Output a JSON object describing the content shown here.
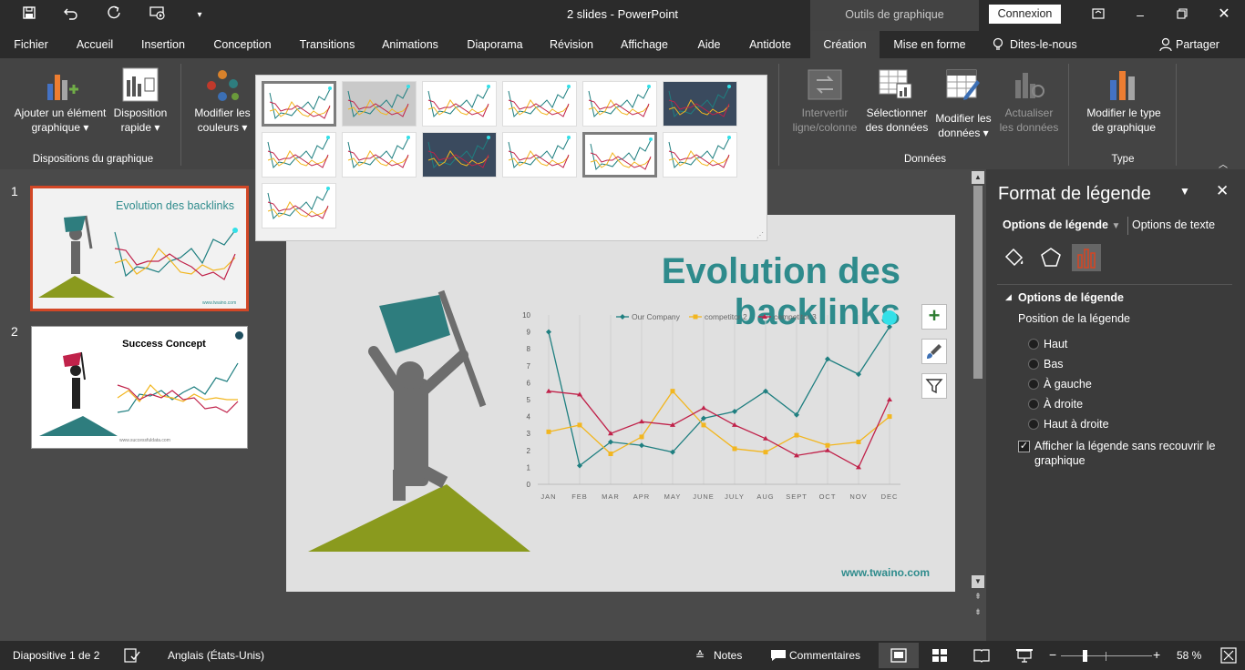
{
  "window": {
    "doc_title": "2 slides  -  PowerPoint",
    "tools_context": "Outils de graphique",
    "connexion": "Connexion"
  },
  "tabs": [
    {
      "label": "Fichier"
    },
    {
      "label": "Accueil"
    },
    {
      "label": "Insertion"
    },
    {
      "label": "Conception"
    },
    {
      "label": "Transitions"
    },
    {
      "label": "Animations"
    },
    {
      "label": "Diaporama"
    },
    {
      "label": "Révision"
    },
    {
      "label": "Affichage"
    },
    {
      "label": "Aide"
    },
    {
      "label": "Antidote"
    },
    {
      "label": "Création"
    },
    {
      "label": "Mise en forme"
    }
  ],
  "tell_me": "Dites-le-nous",
  "share": "Partager",
  "ribbon": {
    "add_element": [
      "Ajouter un élément",
      "graphique"
    ],
    "quick_layout": [
      "Disposition",
      "rapide"
    ],
    "change_colors": [
      "Modifier les",
      "couleurs"
    ],
    "group_layouts": "Dispositions du graphique",
    "switch_row_col": [
      "Intervertir",
      "ligne/colonne"
    ],
    "select_data": [
      "Sélectionner",
      "des données"
    ],
    "edit_data": [
      "Modifier les",
      "données"
    ],
    "refresh_data": [
      "Actualiser",
      "les données"
    ],
    "group_data": "Données",
    "change_type": [
      "Modifier le type",
      "de graphique"
    ],
    "group_type": "Type"
  },
  "slides": [
    {
      "num": "1",
      "title": "Evolution des backlinks",
      "footer": "www.twaino.com"
    },
    {
      "num": "2",
      "title": "Success Concept",
      "footer": "www.successfuldata.com"
    }
  ],
  "slide": {
    "title": "Evolution des backlinks",
    "footer": "www.twaino.com"
  },
  "chart_data": {
    "type": "line",
    "categories": [
      "JAN",
      "FEB",
      "MAR",
      "APR",
      "MAY",
      "JUNE",
      "JULY",
      "AUG",
      "SEPT",
      "OCT",
      "NOV",
      "DEC"
    ],
    "series": [
      {
        "name": "Our Company",
        "color": "#1f7f80",
        "values": [
          9,
          1.1,
          2.5,
          2.3,
          1.9,
          3.9,
          4.3,
          5.5,
          4.1,
          7.4,
          6.5,
          9.3
        ]
      },
      {
        "name": "competitor 2",
        "color": "#f2b61f",
        "values": [
          3.1,
          3.5,
          1.8,
          2.8,
          5.5,
          3.5,
          2.1,
          1.9,
          2.9,
          2.3,
          2.5,
          4
        ]
      },
      {
        "name": "competitor 3",
        "color": "#c0224a",
        "values": [
          5.5,
          5.3,
          3,
          3.7,
          3.5,
          4.5,
          3.5,
          2.7,
          1.7,
          2,
          1,
          5
        ]
      }
    ],
    "ylim": [
      0,
      10
    ],
    "yticks": [
      "0",
      "1",
      "2",
      "3",
      "4",
      "5",
      "6",
      "7",
      "8",
      "9",
      "10"
    ],
    "legend_position": "top",
    "grid": true
  },
  "format_panel": {
    "title": "Format de légende",
    "tab_legend": "Options de légende",
    "tab_text": "Options de texte",
    "section": "Options de légende",
    "position_label": "Position de la légende",
    "options": [
      "Haut",
      "Bas",
      "À gauche",
      "À droite",
      "Haut à droite"
    ],
    "checkbox_label": [
      "Afficher la légende sans recouvrir le",
      "graphique"
    ],
    "checkbox_checked": true
  },
  "status": {
    "slide_counter": "Diapositive 1 de 2",
    "language": "Anglais (États-Unis)",
    "notes": "Notes",
    "comments": "Commentaires",
    "zoom": "58 %"
  }
}
